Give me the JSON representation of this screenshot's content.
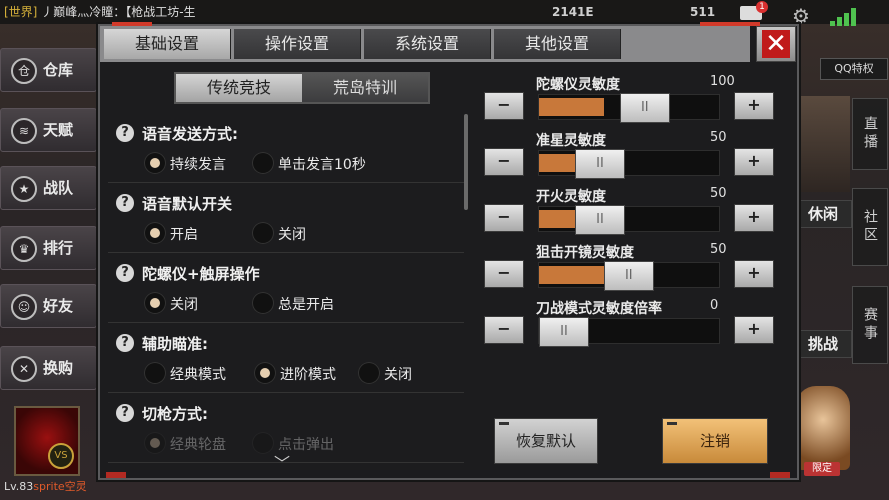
{
  "chat": {
    "channel": "[世界]",
    "message": "丿巅峰灬冷瞳：【枪战工坊-生"
  },
  "top": {
    "num1": "2141E",
    "num2": "511",
    "mail_badge": "1"
  },
  "side_menu": [
    {
      "label": "仓库",
      "icon": "warehouse-icon",
      "glyph": "仓"
    },
    {
      "label": "天赋",
      "icon": "talent-icon",
      "glyph": "≋"
    },
    {
      "label": "战队",
      "icon": "team-star-icon",
      "glyph": "★"
    },
    {
      "label": "排行",
      "icon": "trophy-icon",
      "glyph": "♛"
    },
    {
      "label": "好友",
      "icon": "friends-icon",
      "glyph": "☺"
    },
    {
      "label": "换购",
      "icon": "exchange-icon",
      "glyph": "✕"
    }
  ],
  "avatar": {
    "vs": "VS",
    "level": "Lv.83",
    "name": "sprite空灵"
  },
  "right": {
    "qq": "QQ特权",
    "live": "直播",
    "community": "社区",
    "match": "赛事",
    "leisure": "休闲",
    "challenge": "挑战",
    "mascot_tag": "限定"
  },
  "dialog": {
    "tabs": [
      "基础设置",
      "操作设置",
      "系统设置",
      "其他设置"
    ],
    "active_tab": 0,
    "close_label": "✕",
    "subtabs": [
      "传统竞技",
      "荒岛特训"
    ],
    "options": [
      {
        "title": "语音发送方式:",
        "choices": [
          {
            "label": "持续发言",
            "on": true
          },
          {
            "label": "单击发言10秒",
            "on": false
          }
        ]
      },
      {
        "title": "语音默认开关",
        "choices": [
          {
            "label": "开启",
            "on": true
          },
          {
            "label": "关闭",
            "on": false
          }
        ]
      },
      {
        "title": "陀螺仪+触屏操作",
        "choices": [
          {
            "label": "关闭",
            "on": true
          },
          {
            "label": "总是开启",
            "on": false
          }
        ]
      },
      {
        "title": "辅助瞄准:",
        "choices": [
          {
            "label": "经典模式",
            "on": false
          },
          {
            "label": "进阶模式",
            "on": true
          },
          {
            "label": "关闭",
            "on": false
          }
        ]
      },
      {
        "title": "切枪方式:",
        "choices": [
          {
            "label": "经典轮盘",
            "on": true
          },
          {
            "label": "点击弹出",
            "on": false
          }
        ]
      }
    ],
    "sliders": [
      {
        "label": "陀螺仪灵敏度",
        "value": 100,
        "fill": 0.36
      },
      {
        "label": "准星灵敏度",
        "value": 50,
        "fill": 0.2
      },
      {
        "label": "开火灵敏度",
        "value": 50,
        "fill": 0.2
      },
      {
        "label": "狙击开镜灵敏度",
        "value": 50,
        "fill": 0.36
      },
      {
        "label": "刀战模式灵敏度倍率",
        "value": 0,
        "fill": 0
      }
    ],
    "minus_label": "−",
    "plus_label": "+",
    "thumb_label": "II",
    "reset_label": "恢复默认",
    "logout_label": "注销"
  }
}
